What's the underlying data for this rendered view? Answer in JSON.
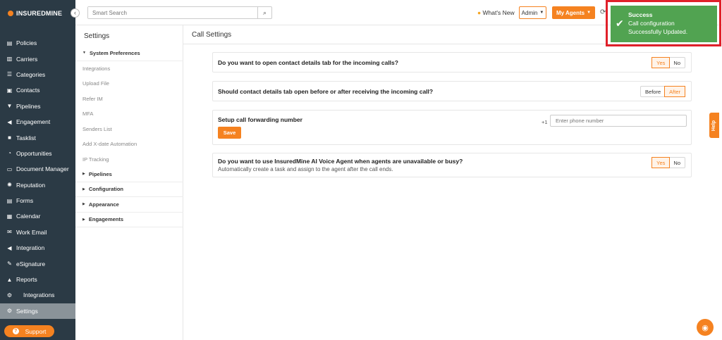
{
  "brand": {
    "name": "INSUREDMINE"
  },
  "sidebar": {
    "items": [
      {
        "label": "Policies",
        "icon": "policies-icon",
        "glyph": "▤"
      },
      {
        "label": "Carriers",
        "icon": "carriers-icon",
        "glyph": "▥"
      },
      {
        "label": "Categories",
        "icon": "categories-icon",
        "glyph": "☰"
      },
      {
        "label": "Contacts",
        "icon": "contacts-icon",
        "glyph": "▣"
      },
      {
        "label": "Pipelines",
        "icon": "pipelines-icon",
        "glyph": "▼"
      },
      {
        "label": "Engagement",
        "icon": "engagement-icon",
        "glyph": "◀"
      },
      {
        "label": "Tasklist",
        "icon": "tasklist-icon",
        "glyph": "■"
      },
      {
        "label": "Opportunities",
        "icon": "opportunities-icon",
        "glyph": "◔"
      },
      {
        "label": "Document Manager",
        "icon": "folder-icon",
        "glyph": "▭"
      },
      {
        "label": "Reputation",
        "icon": "reputation-icon",
        "glyph": "✺"
      },
      {
        "label": "Forms",
        "icon": "forms-icon",
        "glyph": "▤"
      },
      {
        "label": "Calendar",
        "icon": "calendar-icon",
        "glyph": "▦"
      },
      {
        "label": "Work Email",
        "icon": "email-icon",
        "glyph": "✉"
      },
      {
        "label": "Integration",
        "icon": "integration-icon",
        "glyph": "◀"
      },
      {
        "label": "eSignature",
        "icon": "esignature-icon",
        "glyph": "✎"
      },
      {
        "label": "Reports",
        "icon": "reports-icon",
        "glyph": "▲"
      },
      {
        "label": "Integrations",
        "icon": "integrations-icon",
        "glyph": "⚙"
      },
      {
        "label": "Settings",
        "icon": "gear-icon",
        "glyph": "⚙"
      }
    ],
    "active_index": 17,
    "support_label": "Support"
  },
  "topbar": {
    "search_placeholder": "Smart Search",
    "whats_new": "What's New",
    "admin_label": "Admin",
    "my_agents_label": "My Agents"
  },
  "settings_panel": {
    "title": "Settings",
    "items": [
      {
        "label": "System Preferences",
        "type": "group"
      },
      {
        "label": "Integrations",
        "type": "item"
      },
      {
        "label": "Upload File",
        "type": "item"
      },
      {
        "label": "Refer IM",
        "type": "item"
      },
      {
        "label": "MFA",
        "type": "item"
      },
      {
        "label": "Senders List",
        "type": "item"
      },
      {
        "label": "Add X-date Automation",
        "type": "item"
      },
      {
        "label": "IP Tracking",
        "type": "item"
      },
      {
        "label": "Pipelines",
        "type": "group"
      },
      {
        "label": "Configuration",
        "type": "group"
      },
      {
        "label": "Appearance",
        "type": "group"
      },
      {
        "label": "Engagements",
        "type": "group"
      }
    ]
  },
  "call_settings": {
    "title": "Call Settings",
    "q1": {
      "question": "Do you want to open contact details tab for the incoming calls?",
      "opt_a": "Yes",
      "opt_b": "No",
      "selected": "Yes"
    },
    "q2": {
      "question": "Should contact details tab open before or after receiving the incoming call?",
      "opt_a": "Before",
      "opt_b": "After",
      "selected": "After"
    },
    "q3": {
      "question": "Setup call forwarding number",
      "prefix": "+1",
      "phone_placeholder": "Enter phone number",
      "save_label": "Save"
    },
    "q4": {
      "question": "Do you want to use InsuredMine AI Voice Agent when agents are unavailable or busy?",
      "description": "Automatically create a task and assign to the agent after the call ends.",
      "opt_a": "Yes",
      "opt_b": "No",
      "selected": "Yes"
    }
  },
  "toast": {
    "title": "Success",
    "line1": "Call configuration",
    "line2": "Successfully Updated."
  },
  "help_label": "Help",
  "colors": {
    "accent": "#f58220",
    "sidebar": "#2b3a45",
    "success": "#51a351",
    "highlight_frame": "#e0202a"
  }
}
